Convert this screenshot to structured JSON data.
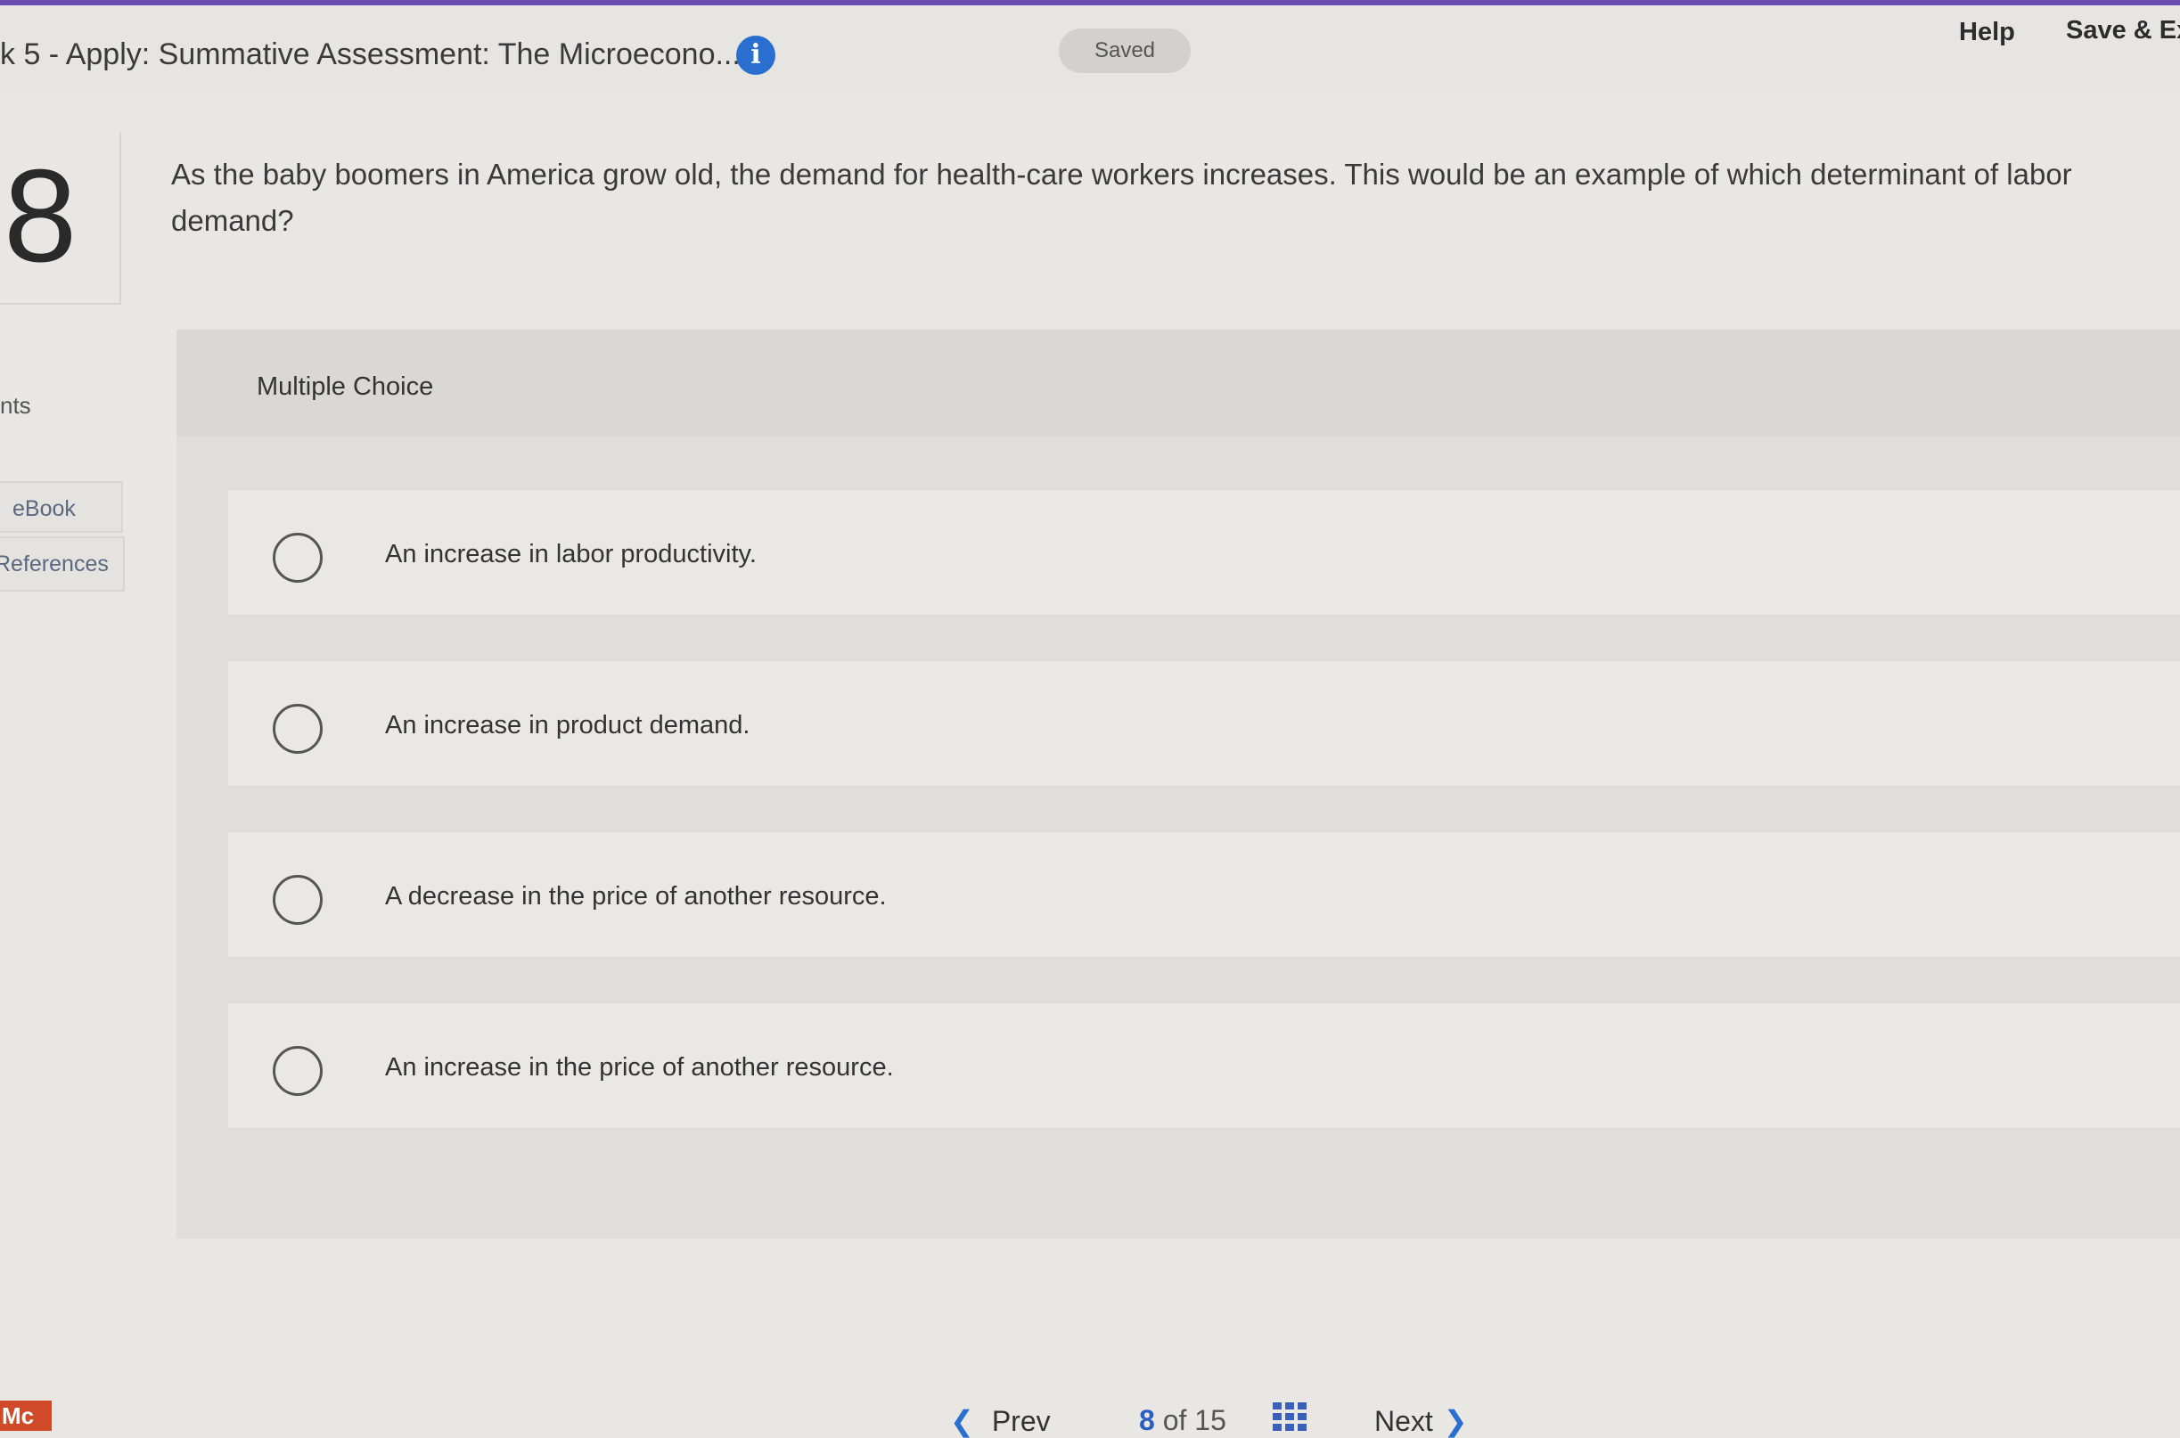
{
  "header": {
    "title": "k 5 - Apply: Summative Assessment: The Microecono...",
    "info_icon": "i",
    "saved_label": "Saved",
    "help_label": "Help",
    "save_exit_label": "Save & Ex"
  },
  "question": {
    "number": "8",
    "text": "As the baby boomers in America grow old, the demand for health-care workers increases. This would be an example of which determinant of labor demand?"
  },
  "sidebar": {
    "points_label": "nts",
    "tabs": [
      {
        "label": "eBook"
      },
      {
        "label": "References"
      }
    ]
  },
  "multiple_choice": {
    "label": "Multiple Choice",
    "choices": [
      {
        "text": "An increase in labor productivity."
      },
      {
        "text": "An increase in product demand."
      },
      {
        "text": "A decrease in the price of another resource."
      },
      {
        "text": "An increase in the price of another resource."
      }
    ]
  },
  "footer": {
    "badge": "Mc",
    "prev_label": "Prev",
    "current_page": "8",
    "of_label": "of",
    "total_pages": "15",
    "next_label": "Next"
  },
  "colors": {
    "accent_bar": "#6b4bb0",
    "link_blue": "#2a6fd0",
    "badge_red": "#d04a2a"
  }
}
